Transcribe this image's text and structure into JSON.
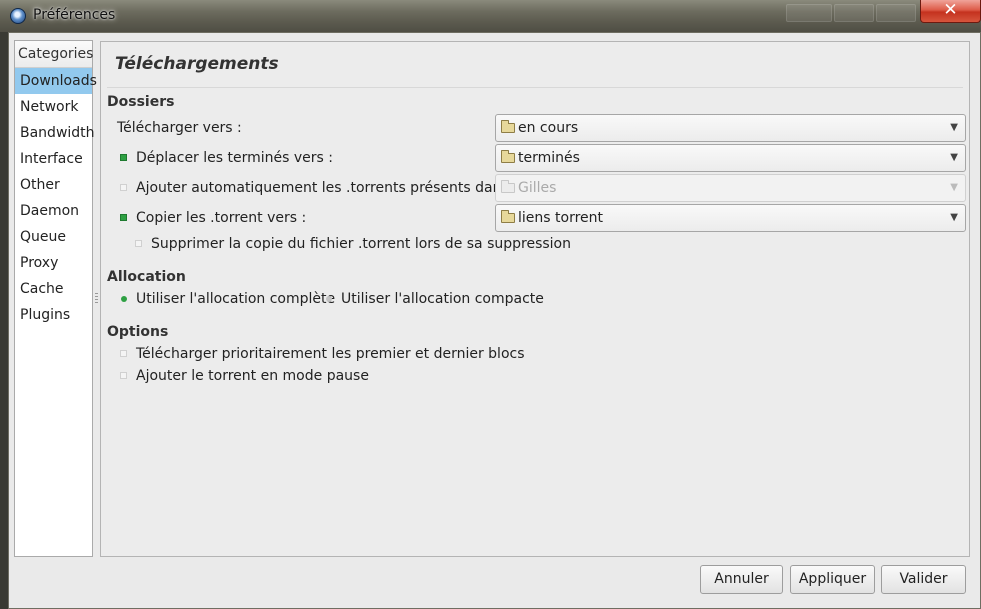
{
  "window": {
    "title": "Préférences",
    "close_glyph": "✕"
  },
  "sidebar": {
    "header": "Categories",
    "items": [
      {
        "label": "Downloads",
        "selected": true
      },
      {
        "label": "Network"
      },
      {
        "label": "Bandwidth"
      },
      {
        "label": "Interface"
      },
      {
        "label": "Other"
      },
      {
        "label": "Daemon"
      },
      {
        "label": "Queue"
      },
      {
        "label": "Proxy"
      },
      {
        "label": "Cache"
      },
      {
        "label": "Plugins"
      }
    ]
  },
  "page": {
    "title": "Téléchargements",
    "dossiers": {
      "heading": "Dossiers",
      "download_to": {
        "label": "Télécharger vers :",
        "value": "en cours"
      },
      "move_completed": {
        "label": "Déplacer les terminés vers :",
        "checked": true,
        "value": "terminés"
      },
      "autoadd": {
        "label": "Ajouter automatiquement les .torrents présents dans :",
        "checked": false,
        "value": "Gilles",
        "enabled": false
      },
      "copy_torrent": {
        "label": "Copier les .torrent vers :",
        "checked": true,
        "value": "liens torrent"
      },
      "delete_copy": {
        "label": "Supprimer la copie du fichier .torrent lors de sa suppression",
        "checked": false
      }
    },
    "allocation": {
      "heading": "Allocation",
      "full": {
        "label": "Utiliser l'allocation complète",
        "selected": true
      },
      "compact": {
        "label": "Utiliser l'allocation compacte",
        "selected": false
      }
    },
    "options": {
      "heading": "Options",
      "prioritize": {
        "label": "Télécharger prioritairement les premier et dernier blocs",
        "checked": false
      },
      "add_paused": {
        "label": "Ajouter le torrent en mode pause",
        "checked": false
      }
    }
  },
  "buttons": {
    "cancel": "Annuler",
    "apply": "Appliquer",
    "ok": "Valider"
  },
  "colors": {
    "accent_green": "#2ea043",
    "selection": "#92c9ee"
  }
}
